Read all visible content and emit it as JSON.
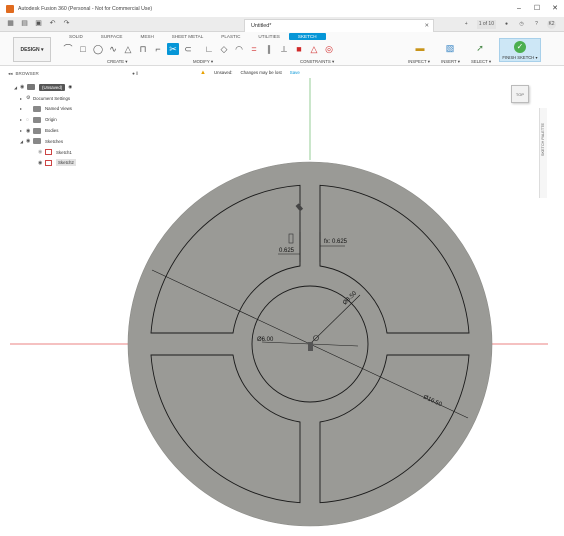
{
  "window": {
    "title": "Autodesk Fusion 360 (Personal - Not for Commercial Use)",
    "controls": [
      "–",
      "☐",
      "✕"
    ]
  },
  "tabbar": {
    "document_tab": "Untitled*",
    "close_glyph": "✕",
    "quick_icons": [
      "grid-icon",
      "file-icon",
      "save-icon",
      "undo-icon",
      "redo-icon"
    ],
    "right_badge": "1 of 10",
    "user_initials": "K2"
  },
  "ribbon": {
    "workspace_label": "DESIGN ▾",
    "tabs": [
      "SOLID",
      "SURFACE",
      "MESH",
      "SHEET METAL",
      "PLASTIC",
      "UTILITIES",
      "SKETCH"
    ],
    "active_tab": "SKETCH",
    "groups": {
      "create": "CREATE ▾",
      "modify": "MODIFY ▾",
      "constraints": "CONSTRAINTS ▾",
      "inspect": "INSPECT ▾",
      "insert": "INSERT ▾",
      "select": "SELECT ▾"
    },
    "finish_label": "FINISH SKETCH ▾"
  },
  "message": {
    "unsaved": "Unsaved:",
    "text": "Changes may be lost",
    "save_link": "Save"
  },
  "browser": {
    "title": "BROWSER",
    "items": [
      {
        "label": "(Unsaved)",
        "level": 0
      },
      {
        "label": "Document Settings",
        "level": 1
      },
      {
        "label": "Named Views",
        "level": 1
      },
      {
        "label": "Origin",
        "level": 1
      },
      {
        "label": "Bodies",
        "level": 1
      },
      {
        "label": "Sketches",
        "level": 1
      },
      {
        "label": "Sketch1",
        "level": 2
      },
      {
        "label": "Sketch2",
        "level": 2
      }
    ]
  },
  "viewcube": {
    "label": "TOP"
  },
  "comments_panel": {
    "label": "SKETCH PALETTE"
  },
  "dimensions": {
    "gap_left": "0.625",
    "gap_right": "fx: 0.625",
    "inner_diameter": "Ø6.00",
    "ring_diameter": "Ø8.50",
    "outer_diameter": "Ø16.50"
  },
  "colors": {
    "accent": "#0696d7",
    "plate": "#9a9a96",
    "sketch_line": "#1a1a1a",
    "axis_red": "#e45a5a",
    "axis_green": "#68b86a"
  }
}
